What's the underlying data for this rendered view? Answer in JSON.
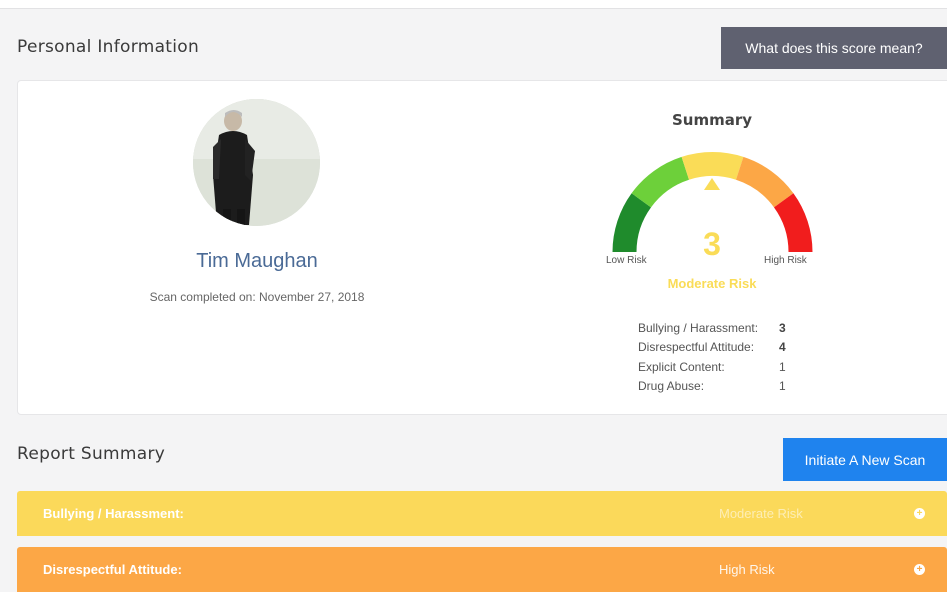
{
  "personal": {
    "title": "Personal Information",
    "score_button": "What does this score mean?",
    "name": "Tim Maughan",
    "scan_date": "Scan completed on: November 27, 2018"
  },
  "summary": {
    "title": "Summary",
    "low_label": "Low Risk",
    "high_label": "High Risk",
    "score": "3",
    "risk_level": "Moderate Risk",
    "gauge_colors": [
      "#1f8b2c",
      "#6dd03a",
      "#fadc57",
      "#fca746",
      "#f11d1d"
    ],
    "metrics": [
      {
        "label": "Bullying / Harassment:",
        "value": "3"
      },
      {
        "label": "Disrespectful Attitude:",
        "value": "4"
      },
      {
        "label": "Explicit Content:",
        "value": "1"
      },
      {
        "label": "Drug Abuse:",
        "value": "1"
      }
    ]
  },
  "report": {
    "title": "Report Summary",
    "new_scan_button": "Initiate A New Scan",
    "rows": [
      {
        "name": "Bullying / Harassment:",
        "status": "Moderate Risk",
        "color": "#fbd95a"
      },
      {
        "name": "Disrespectful Attitude:",
        "status": "High Risk",
        "color": "#fca746"
      }
    ]
  }
}
